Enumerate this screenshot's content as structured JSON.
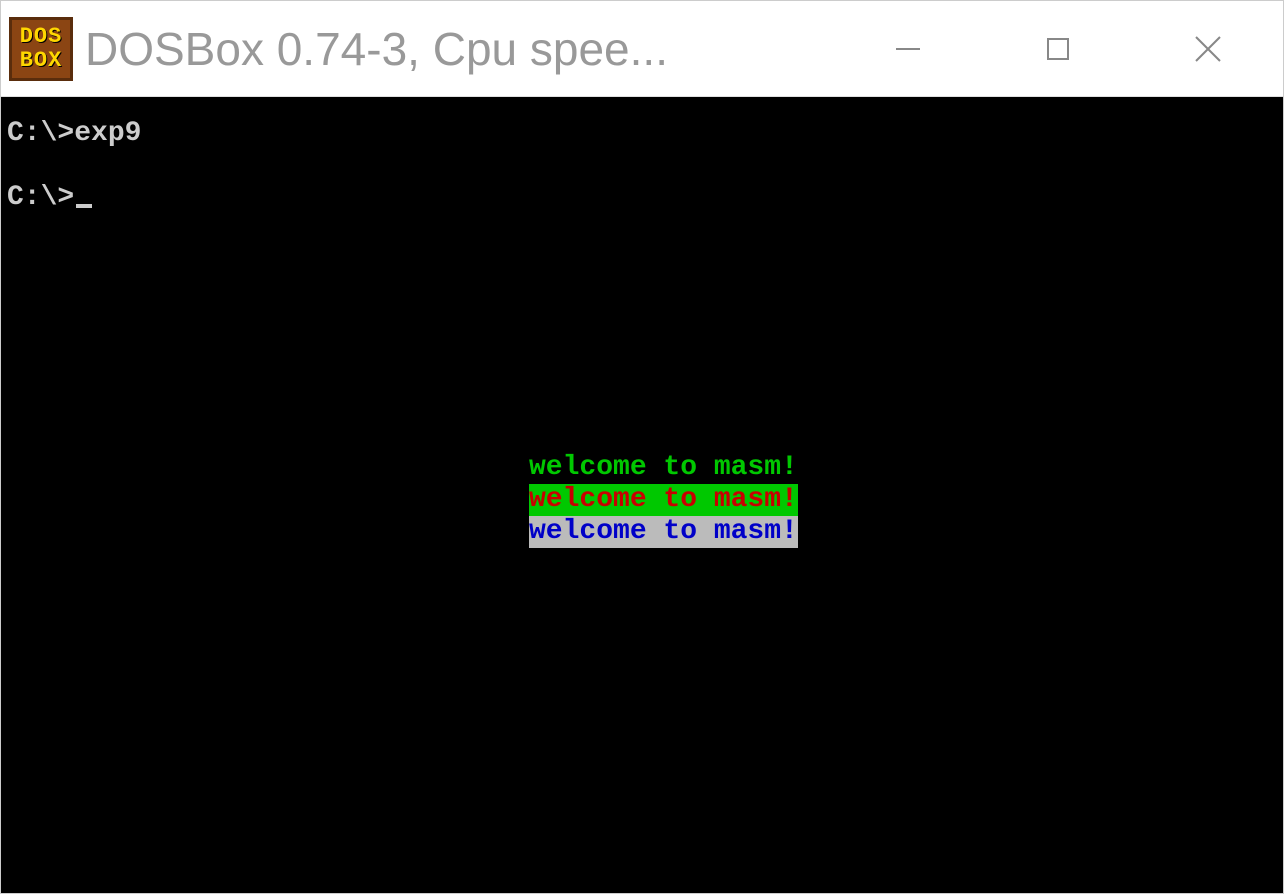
{
  "titlebar": {
    "icon_line1": "DOS",
    "icon_line2": "BOX",
    "title": "DOSBox 0.74-3, Cpu spee..."
  },
  "terminal": {
    "prompt1": "C:\\>",
    "command1": "exp9",
    "prompt2": "C:\\>",
    "output": [
      {
        "text": "welcome to masm!",
        "fg": "#00c800",
        "bg": "#000000"
      },
      {
        "text": "welcome to masm!",
        "fg": "#c80000",
        "bg": "#00c800"
      },
      {
        "text": "welcome to masm!",
        "fg": "#0000c8",
        "bg": "#bbbbbb"
      }
    ]
  }
}
